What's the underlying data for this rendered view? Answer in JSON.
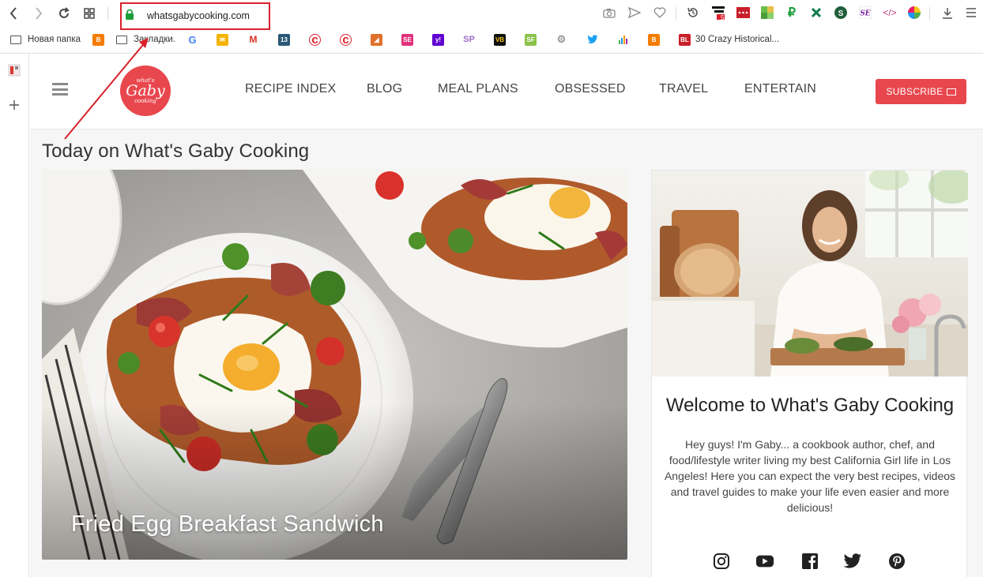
{
  "browser": {
    "url": "whatsgabycooking.com",
    "tab_badge": "5",
    "bookmarks": [
      {
        "label": "Новая папка",
        "icon": "folder-icon"
      },
      {
        "label": "",
        "icon": "blogger-icon"
      },
      {
        "label": "Закладки.",
        "icon": "folder-icon"
      },
      {
        "label": "",
        "icon": "google-icon"
      },
      {
        "label": "",
        "icon": "mail-icon"
      },
      {
        "label": "",
        "icon": "gmail-icon"
      },
      {
        "label": "",
        "icon": "calendar-icon"
      },
      {
        "label": "",
        "icon": "copyright-icon"
      },
      {
        "label": "",
        "icon": "copyright-icon"
      },
      {
        "label": "",
        "icon": "orange-icon"
      },
      {
        "label": "",
        "icon": "se-icon"
      },
      {
        "label": "",
        "icon": "yahoo-icon"
      },
      {
        "label": "",
        "icon": "sp-icon"
      },
      {
        "label": "",
        "icon": "vb-icon"
      },
      {
        "label": "",
        "icon": "sf-icon"
      },
      {
        "label": "",
        "icon": "gear-icon"
      },
      {
        "label": "",
        "icon": "twitter-icon"
      },
      {
        "label": "",
        "icon": "chart-icon"
      },
      {
        "label": "",
        "icon": "blogger-icon"
      },
      {
        "label": "30 Crazy Historical...",
        "icon": "bl-icon"
      }
    ]
  },
  "site": {
    "nav": [
      "RECIPE INDEX",
      "BLOG",
      "MEAL PLANS",
      "OBSESSED",
      "TRAVEL",
      "ENTERTAIN"
    ],
    "subscribe_label": "SUBSCRIBE",
    "logo_top": "what's",
    "logo_main": "Gaby",
    "logo_bottom": "cooking",
    "today_title": "Today on What's Gaby Cooking",
    "hero_title": "Fried Egg Breakfast Sandwich",
    "welcome_title": "Welcome to What's Gaby Cooking",
    "welcome_body": "Hey guys! I'm Gaby... a cookbook author, chef, and food/lifestyle writer living my best California Girl life in Los Angeles! Here you can expect the very best recipes, videos and travel guides to make your life even easier and more delicious!",
    "social": [
      "instagram-icon",
      "youtube-icon",
      "facebook-icon",
      "twitter-icon",
      "pinterest-icon"
    ]
  },
  "colors": {
    "brand": "#e8474e",
    "annotation": "#d9212b"
  }
}
